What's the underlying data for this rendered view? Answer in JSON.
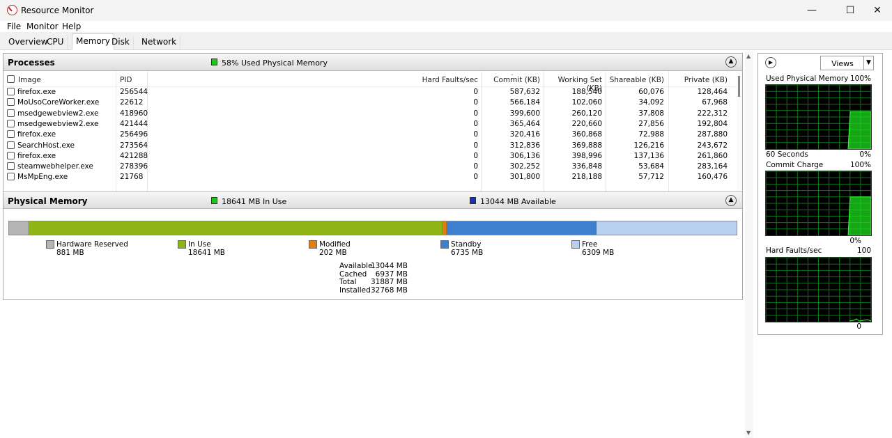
{
  "window": {
    "title": "Resource Monitor",
    "minimize": "—",
    "maximize": "☐",
    "close": "✕"
  },
  "menu": [
    "File",
    "Monitor",
    "Help"
  ],
  "tabs": [
    "Overview",
    "CPU",
    "Memory",
    "Disk",
    "Network"
  ],
  "active_tab": "Memory",
  "processes": {
    "title": "Processes",
    "summary": "58% Used Physical Memory",
    "summary_color": "#21c21a",
    "columns": [
      "Image",
      "PID",
      "Hard Faults/sec",
      "Commit (KB)",
      "Working Set (KB)",
      "Shareable (KB)",
      "Private (KB)"
    ],
    "rows": [
      [
        "firefox.exe",
        "256544",
        "0",
        "587,632",
        "188,540",
        "60,076",
        "128,464"
      ],
      [
        "MoUsoCoreWorker.exe",
        "22612",
        "0",
        "566,184",
        "102,060",
        "34,092",
        "67,968"
      ],
      [
        "msedgewebview2.exe",
        "418960",
        "0",
        "399,600",
        "260,120",
        "37,808",
        "222,312"
      ],
      [
        "msedgewebview2.exe",
        "421444",
        "0",
        "365,464",
        "220,660",
        "27,856",
        "192,804"
      ],
      [
        "firefox.exe",
        "256496",
        "0",
        "320,416",
        "360,868",
        "72,988",
        "287,880"
      ],
      [
        "SearchHost.exe",
        "273564",
        "0",
        "312,836",
        "369,888",
        "126,216",
        "243,672"
      ],
      [
        "firefox.exe",
        "421288",
        "0",
        "306,136",
        "398,996",
        "137,136",
        "261,860"
      ],
      [
        "steamwebhelper.exe",
        "278396",
        "0",
        "302,252",
        "336,848",
        "53,684",
        "283,164"
      ],
      [
        "MsMpEng.exe",
        "21768",
        "0",
        "301,800",
        "218,188",
        "57,712",
        "160,476"
      ]
    ]
  },
  "physical_memory": {
    "title": "Physical Memory",
    "in_use_note": "18641 MB In Use",
    "available_note": "13044 MB Available",
    "segments": [
      {
        "label": "Hardware Reserved",
        "value": "881 MB",
        "mb": 881,
        "color": "#b4b4b4"
      },
      {
        "label": "In Use",
        "value": "18641 MB",
        "mb": 18641,
        "color": "#8db516"
      },
      {
        "label": "Modified",
        "value": "202 MB",
        "mb": 202,
        "color": "#e27d10"
      },
      {
        "label": "Standby",
        "value": "6735 MB",
        "mb": 6735,
        "color": "#3f7fcf"
      },
      {
        "label": "Free",
        "value": "6309 MB",
        "mb": 6309,
        "color": "#b8d0ef"
      }
    ],
    "summary": [
      {
        "label": "Available",
        "value": "13044 MB"
      },
      {
        "label": "Cached",
        "value": "6937 MB"
      },
      {
        "label": "Total",
        "value": "31887 MB"
      },
      {
        "label": "Installed",
        "value": "32768 MB"
      }
    ]
  },
  "graphs": {
    "views_label": "Views",
    "used_physical": {
      "label": "Used Physical Memory",
      "max": "100%",
      "min": "0%",
      "time": "60 Seconds",
      "level_percent": 58
    },
    "commit_charge": {
      "label": "Commit Charge",
      "max": "100%",
      "min": "0%",
      "level_percent": 60
    },
    "hard_faults": {
      "label": "Hard Faults/sec",
      "max": "100",
      "min": "0"
    }
  }
}
